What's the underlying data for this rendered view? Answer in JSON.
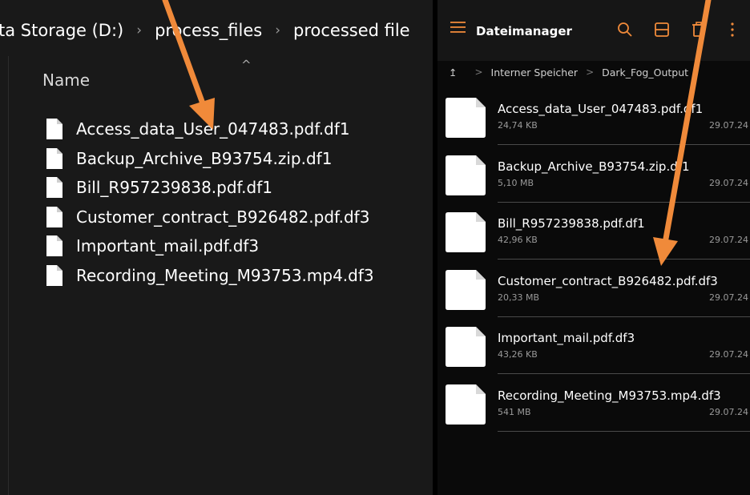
{
  "explorer": {
    "breadcrumb": [
      "ta Storage (D:)",
      "process_files",
      "processed file"
    ],
    "column_header": "Name",
    "files": [
      "Access_data_User_047483.pdf.df1",
      "Backup_Archive_B93754.zip.df1",
      "Bill_R957239838.pdf.df1",
      "Customer_contract_B926482.pdf.df3",
      "Important_mail.pdf.df3",
      "Recording_Meeting_M93753.mp4.df3"
    ]
  },
  "android": {
    "title": "Dateimanager",
    "toolbar_icons": [
      "search-icon",
      "layout-icon",
      "delete-icon",
      "more-icon"
    ],
    "path": [
      "Interner Speicher",
      "Dark_Fog_Output"
    ],
    "files": [
      {
        "name": "Access_data_User_047483.pdf.df1",
        "size": "24,74 KB",
        "date": "29.07.24"
      },
      {
        "name": "Backup_Archive_B93754.zip.df1",
        "size": "5,10 MB",
        "date": "29.07.24"
      },
      {
        "name": "Bill_R957239838.pdf.df1",
        "size": "42,96 KB",
        "date": "29.07.24"
      },
      {
        "name": "Customer_contract_B926482.pdf.df3",
        "size": "20,33 MB",
        "date": "29.07.24"
      },
      {
        "name": "Important_mail.pdf.df3",
        "size": "43,26 KB",
        "date": "29.07.24"
      },
      {
        "name": "Recording_Meeting_M93753.mp4.df3",
        "size": "541 MB",
        "date": "29.07.24"
      }
    ]
  },
  "colors": {
    "accent_orange": "#f08a3a",
    "explorer_bg": "#191919",
    "android_bg": "#0a0a0a"
  }
}
